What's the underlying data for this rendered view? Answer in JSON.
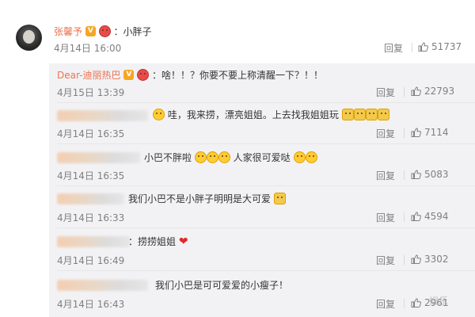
{
  "top_comment": {
    "user": "张馨予",
    "text": "：小胖子",
    "time": "4月14日 16:00",
    "reply": "回复",
    "likes": "51737"
  },
  "replies": [
    {
      "user": "Dear-迪丽热巴",
      "text": "：啥！！？你要不要上称清醒一下？！！",
      "time": "4月15日 13:39",
      "reply": "回复",
      "likes": "22793"
    },
    {
      "text_pre": "哇，我来捞，漂亮姐姐。上去找我姐姐玩",
      "time": "4月14日 16:35",
      "reply": "回复",
      "likes": "7114"
    },
    {
      "text_a": "小巴不胖啦",
      "text_b": "人家很可爱哒",
      "time": "4月14日 16:35",
      "reply": "回复",
      "likes": "5083"
    },
    {
      "text": "我们小巴不是小胖子明明是大可爱",
      "time": "4月14日 16:33",
      "reply": "回复",
      "likes": "4594"
    },
    {
      "text": "：捞捞姐姐",
      "time": "4月14日 16:49",
      "reply": "回复",
      "likes": "3302"
    },
    {
      "text": "我们小巴是可可爱爱的小瘦子！",
      "time": "4月14日 16:43",
      "reply": "回复",
      "likes": "2961"
    }
  ],
  "icons": {
    "thumb": "thumb-up-icon",
    "vbadge": "verified-badge-icon"
  },
  "watermark": "娱乐"
}
